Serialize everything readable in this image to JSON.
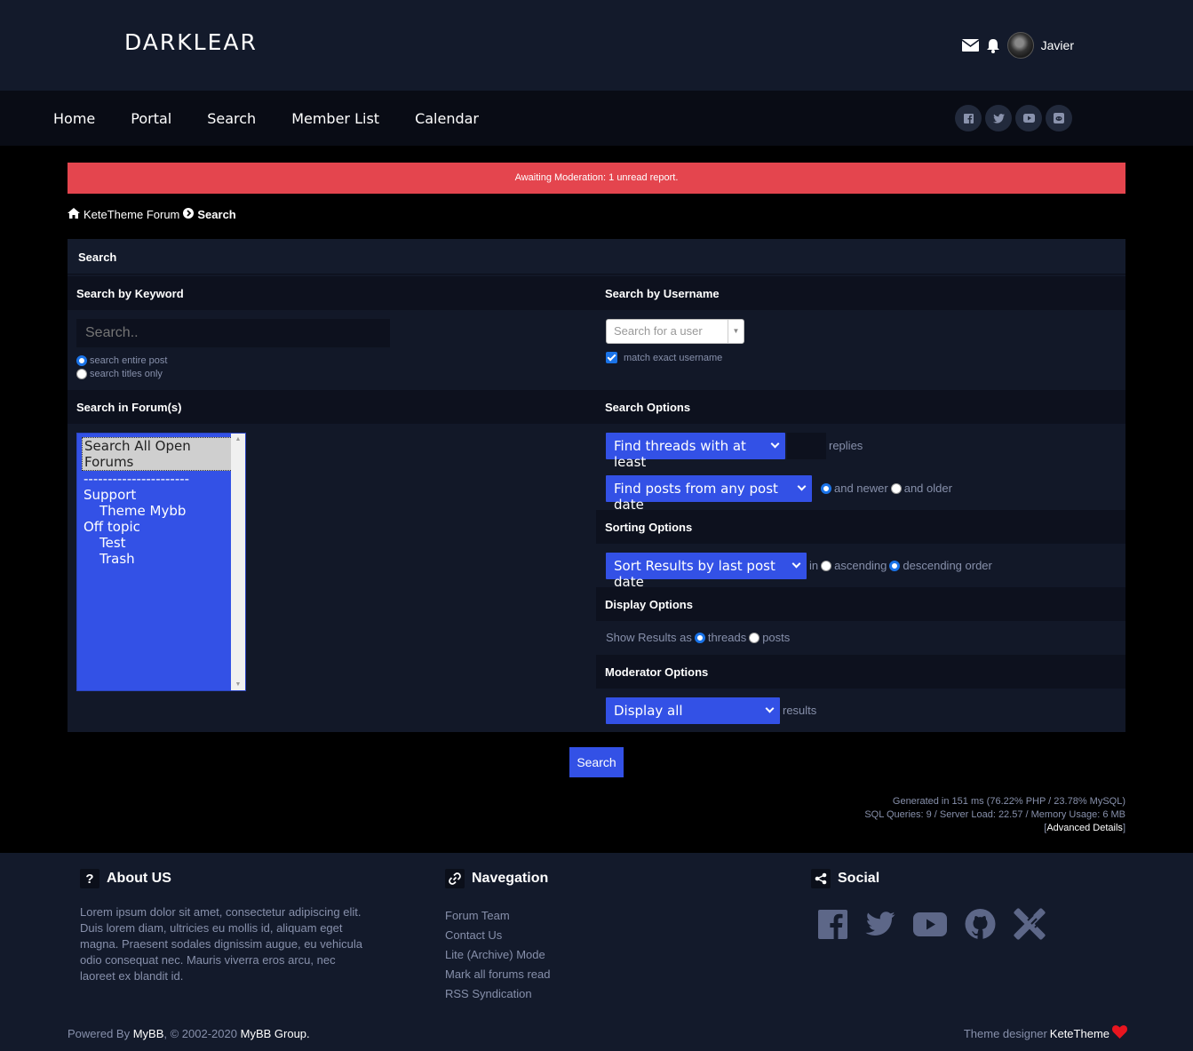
{
  "header": {
    "logo": "DARKLEAR",
    "username": "Javier"
  },
  "nav": [
    "Home",
    "Portal",
    "Search",
    "Member List",
    "Calendar"
  ],
  "alert": "Awaiting Moderation: 1 unread report.",
  "breadcrumb": {
    "root": "KeteTheme Forum",
    "current": "Search"
  },
  "panel": {
    "title": "Search",
    "keyword": {
      "heading": "Search by Keyword",
      "placeholder": "Search..",
      "opt_entire": "search entire post",
      "opt_titles": "search titles only"
    },
    "username": {
      "heading": "Search by Username",
      "placeholder": "Search for a user",
      "match_exact": "match exact username"
    },
    "forums": {
      "heading": "Search in Forum(s)",
      "items": [
        "Search All Open Forums",
        "----------------------",
        "Support",
        "Theme Mybb",
        "Off topic",
        "Test",
        "Trash"
      ]
    },
    "search_options": {
      "heading": "Search Options",
      "threads_select": "Find threads with at least",
      "replies": "replies",
      "posts_select": "Find posts from any post date",
      "newer": "and newer",
      "older": "and older"
    },
    "sorting": {
      "heading": "Sorting Options",
      "sort_select": "Sort Results by last post date",
      "in": "in",
      "ascending": "ascending",
      "descending": "descending order"
    },
    "display": {
      "heading": "Display Options",
      "show_as": "Show Results as",
      "threads": "threads",
      "posts": "posts"
    },
    "moderator": {
      "heading": "Moderator Options",
      "select": "Display all",
      "results": "results"
    },
    "submit": "Search"
  },
  "debug": {
    "line1": "Generated in 151 ms (76.22% PHP / 23.78% MySQL)",
    "line2": "SQL Queries: 9 / Server Load: 22.57 / Memory Usage: 6 MB",
    "advanced": "Advanced Details"
  },
  "footer": {
    "about_title": "About US",
    "about_text": "Lorem ipsum dolor sit amet, consectetur adipiscing elit. Duis lorem diam, ultricies eu mollis id, aliquam eget magna. Praesent sodales dignissim augue, eu vehicula odio consequat nec. Mauris viverra eros arcu, nec laoreet ex blandit id.",
    "nav_title": "Navegation",
    "nav_links": [
      "Forum Team",
      "Contact Us",
      "Lite (Archive) Mode",
      "Mark all forums read",
      "RSS Syndication"
    ],
    "social_title": "Social",
    "powered": "Powered By",
    "mybb": "MyBB",
    "copy": ", © 2002-2020",
    "group": "MyBB Group.",
    "designer_label": "Theme designer",
    "designer_name": "KeteTheme"
  },
  "colors": {
    "accent": "#3351e6",
    "alert": "#e4454e",
    "header_bg": "#131a2b",
    "panel_bg": "#121828"
  }
}
